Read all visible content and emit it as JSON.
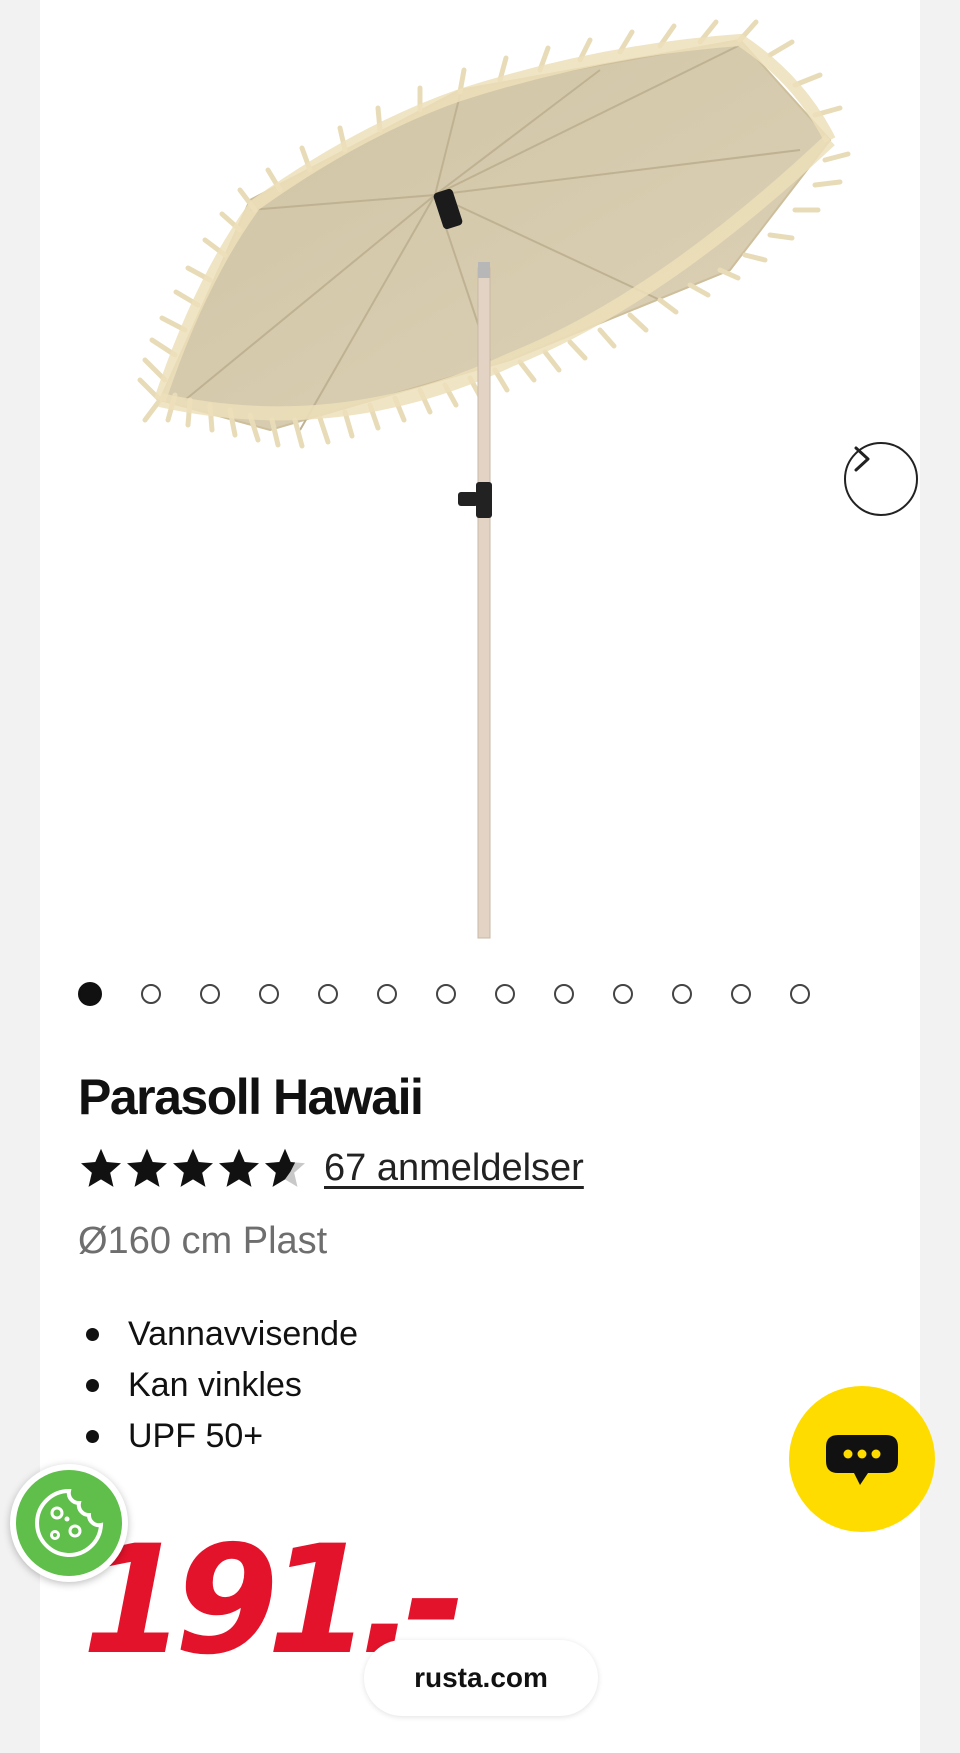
{
  "gallery": {
    "image_alt": "Parasoll Hawaii",
    "total_images": 13,
    "active_index": 0,
    "next_icon": "chevron-right-icon"
  },
  "product": {
    "title": "Parasoll Hawaii",
    "rating": 4.5,
    "rating_max": 5,
    "reviews_text": "67 anmeldelser",
    "subtitle": "Ø160 cm Plast",
    "features": [
      "Vannavvisende",
      "Kan vinkles",
      "UPF 50+"
    ],
    "price": "191.-"
  },
  "chat": {
    "icon": "chat-bubble-icon"
  },
  "cookie": {
    "icon": "cookie-icon"
  },
  "browser": {
    "url": "rusta.com"
  },
  "colors": {
    "price": "#e3132b",
    "chat_button": "#ffdc00",
    "cookie_button": "#5fbf4a",
    "parasol": "#d8cdb2",
    "fringe": "#e6d9b4"
  }
}
